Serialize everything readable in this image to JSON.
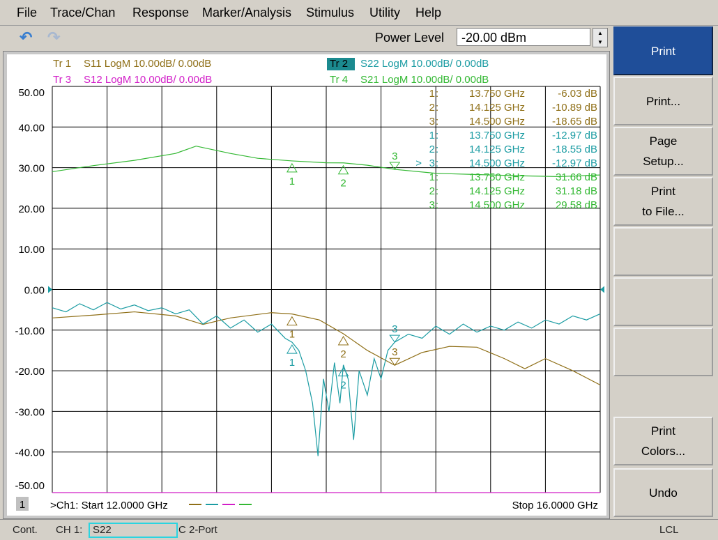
{
  "menu": [
    "File",
    "Trace/Chan",
    "Response",
    "Marker/Analysis",
    "Stimulus",
    "Utility",
    "Help"
  ],
  "toolbar": {
    "undo_icon": "undo-arrow-icon",
    "redo_icon": "redo-arrow-icon",
    "power_label": "Power Level",
    "power_value": "-20.00 dBm"
  },
  "softkeys": [
    "Print",
    "Print...",
    "Page\nSetup...",
    "Print\nto File...",
    "",
    "",
    "",
    "Print\nColors...",
    "Undo"
  ],
  "channel": {
    "number": "1",
    "start": ">Ch1: Start  12.0000 GHz",
    "stop": "Stop  16.0000 GHz"
  },
  "status": {
    "mode": "Cont.",
    "channel": "CH 1:",
    "meas": "S22",
    "cal": "C  2-Port",
    "remote": "LCL"
  },
  "chart_data": {
    "type": "line",
    "xlim": [
      12,
      16
    ],
    "ylim": [
      -50,
      50
    ],
    "yticks": [
      "50.00",
      "40.00",
      "30.00",
      "20.00",
      "10.00",
      "0.00",
      "-10.00",
      "-20.00",
      "-30.00",
      "-40.00",
      "-50.00"
    ],
    "grid": true,
    "reference_level": 0,
    "traces": [
      {
        "label": "Tr 1",
        "param": "S11 LogM 10.00dB/  0.00dB",
        "color": "#8f6f17",
        "active": false,
        "x": [
          12,
          12.3,
          12.6,
          12.9,
          13.1,
          13.3,
          13.6,
          13.75,
          13.95,
          14.125,
          14.3,
          14.5,
          14.7,
          14.9,
          15.1,
          15.3,
          15.45,
          15.6,
          15.8,
          16
        ],
        "y": [
          -7,
          -6.3,
          -5.5,
          -6.5,
          -8.6,
          -7,
          -5.7,
          -6.03,
          -7.5,
          -10.89,
          -15,
          -18.65,
          -15.5,
          -14,
          -14.2,
          -17,
          -19.5,
          -17,
          -20,
          -23.5
        ],
        "markers": [
          {
            "n": "1",
            "freq": "13.750 GHz",
            "val": "-6.03 dB"
          },
          {
            "n": "2",
            "freq": "14.125 GHz",
            "val": "-10.89 dB"
          },
          {
            "n": "3",
            "freq": "14.500 GHz",
            "val": "-18.65 dB"
          }
        ]
      },
      {
        "label": "Tr 2",
        "param": "S22 LogM 10.00dB/  0.00dB",
        "color": "#1b9ca3",
        "active": true,
        "x": [
          12,
          12.1,
          12.2,
          12.3,
          12.4,
          12.5,
          12.6,
          12.7,
          12.8,
          12.9,
          13,
          13.1,
          13.2,
          13.3,
          13.4,
          13.5,
          13.6,
          13.7,
          13.75,
          13.8,
          13.85,
          13.9,
          13.94,
          13.98,
          14.02,
          14.06,
          14.1,
          14.125,
          14.16,
          14.2,
          14.24,
          14.3,
          14.35,
          14.4,
          14.45,
          14.5,
          14.6,
          14.7,
          14.8,
          14.9,
          15,
          15.1,
          15.2,
          15.3,
          15.4,
          15.5,
          15.6,
          15.7,
          15.8,
          15.9,
          16
        ],
        "y": [
          -4.5,
          -5.5,
          -3.5,
          -5,
          -3.2,
          -4.8,
          -3.8,
          -5.2,
          -4.5,
          -6,
          -5,
          -8.5,
          -6.5,
          -9.5,
          -7.5,
          -10.5,
          -8.5,
          -12,
          -12.97,
          -15,
          -20,
          -28,
          -41,
          -22,
          -30,
          -18,
          -28,
          -18.55,
          -22,
          -37,
          -20,
          -26,
          -17,
          -22,
          -15,
          -12.97,
          -11,
          -12,
          -9,
          -11,
          -8.5,
          -10.5,
          -9,
          -10,
          -8,
          -9.5,
          -7.5,
          -8.5,
          -6.5,
          -7.5,
          -6
        ],
        "markers": [
          {
            "n": "1",
            "freq": "13.750 GHz",
            "val": "-12.97 dB"
          },
          {
            "n": "2",
            "freq": "14.125 GHz",
            "val": "-18.55 dB"
          },
          {
            "n": "3",
            "freq": "14.500 GHz",
            "val": "-12.97 dB",
            "active": true
          }
        ]
      },
      {
        "label": "Tr 3",
        "param": "S12 LogM 10.00dB/  0.00dB",
        "color": "#d21ec8",
        "active": false,
        "x": [
          12,
          16
        ],
        "y": [
          -50,
          -50
        ],
        "markers": []
      },
      {
        "label": "Tr 4",
        "param": "S21 LogM 10.00dB/  0.00dB",
        "color": "#33b833",
        "active": false,
        "x": [
          12,
          12.3,
          12.6,
          12.9,
          13.05,
          13.3,
          13.5,
          13.75,
          14,
          14.125,
          14.3,
          14.5,
          14.8,
          15.1,
          15.4,
          15.7,
          16
        ],
        "y": [
          29,
          30.5,
          31.8,
          33.5,
          35.3,
          33.5,
          32.3,
          31.66,
          31.2,
          31.18,
          30.6,
          29.58,
          28.6,
          28.3,
          28,
          27.8,
          28.2
        ],
        "markers": [
          {
            "n": "1",
            "freq": "13.750 GHz",
            "val": "31.66 dB"
          },
          {
            "n": "2",
            "freq": "14.125 GHz",
            "val": "31.18 dB"
          },
          {
            "n": "3",
            "freq": "14.500 GHz",
            "val": "29.58 dB"
          }
        ]
      }
    ]
  }
}
